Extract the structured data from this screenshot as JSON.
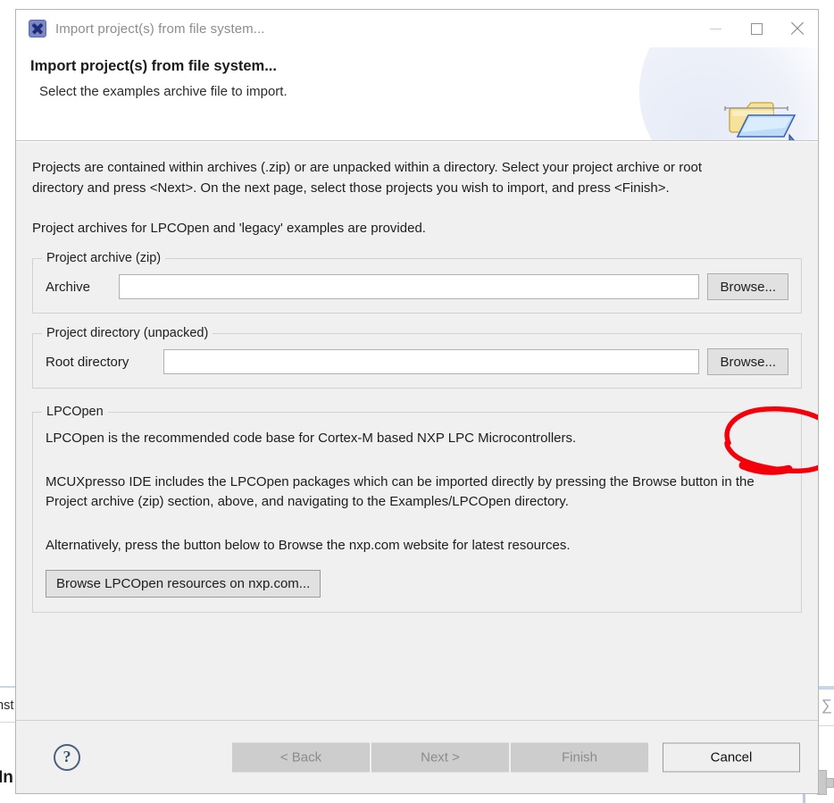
{
  "window": {
    "title": "Import project(s) from file system...",
    "app_icon": "mcuxpresso-x-icon",
    "minimize_label": "Minimize",
    "maximize_label": "Maximize",
    "close_label": "Close"
  },
  "banner": {
    "title": "Import project(s) from file system...",
    "subtitle": "Select the examples archive file to import.",
    "icon": "import-folder-icon"
  },
  "body": {
    "paragraph_1": "Projects are contained within archives (.zip) or are unpacked within a directory. Select your project archive or root directory and press <Next>. On the next page, select those projects you wish to import, and press <Finish>.",
    "paragraph_2": "Project archives for LPCOpen and 'legacy' examples are provided."
  },
  "project_archive_group": {
    "legend": "Project archive (zip)",
    "field_label": "Archive",
    "field_value": "",
    "field_placeholder": "",
    "browse_label": "Browse..."
  },
  "project_directory_group": {
    "legend": "Project directory (unpacked)",
    "field_label": "Root directory",
    "field_value": "",
    "field_placeholder": "",
    "browse_label": "Browse..."
  },
  "lpcopen_group": {
    "legend": "LPCOpen",
    "line_1": "LPCOpen is the recommended code base for Cortex-M based NXP LPC Microcontrollers.",
    "line_2": "MCUXpresso IDE includes the LPCOpen packages which can be imported directly by pressing the Browse button in the Project archive (zip) section, above, and navigating to the Examples/LPCOpen directory.",
    "line_3": "Alternatively, press the button below to Browse the nxp.com website for latest resources.",
    "button_label": "Browse LPCOpen resources on nxp.com..."
  },
  "footer": {
    "help_glyph": "?",
    "back_label": "< Back",
    "next_label": "Next >",
    "finish_label": "Finish",
    "cancel_label": "Cancel"
  },
  "annotation": {
    "type": "hand-drawn-red-circle",
    "color": "#f30000",
    "targets": "Browse... button of Project archive (zip)"
  },
  "background": {
    "left_text": "nst",
    "left_bold_text": "In",
    "right_glyph": "∑"
  },
  "colors": {
    "dialog_background": "#f0f0f0",
    "banner_background": "#ffffff",
    "accent_blue": "#4a6080",
    "annotation_red": "#f30000",
    "input_background": "#ffffff",
    "button_face": "#e1e1e1",
    "disabled_button": "#cdcdcd"
  }
}
